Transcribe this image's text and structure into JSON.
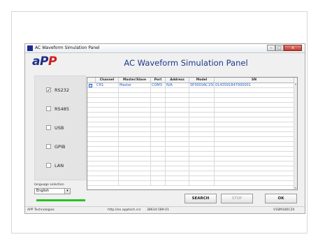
{
  "window": {
    "title": "AC Waveform Simulation Panel",
    "controls": {
      "minimize": "–",
      "maximize": "□",
      "close": "x"
    }
  },
  "header": {
    "logo_main": "aP",
    "logo_accent": "P",
    "panel_title": "AC Waveform Simulation Panel"
  },
  "interfaces": [
    {
      "label": "RS232",
      "checked": true,
      "mark": "✓"
    },
    {
      "label": "RS485",
      "checked": false,
      "mark": ""
    },
    {
      "label": "USB",
      "checked": false,
      "mark": ""
    },
    {
      "label": "GPIB",
      "checked": false,
      "mark": ""
    },
    {
      "label": "LAN",
      "checked": false,
      "mark": ""
    }
  ],
  "language": {
    "label": "language selection",
    "value": "English",
    "arrow": "▾"
  },
  "progress": {
    "percent": 100,
    "color": "#27c227"
  },
  "table": {
    "columns": [
      "",
      "Channel",
      "Master/Slave",
      "Port",
      "Address",
      "Model",
      "SN"
    ],
    "rows": [
      {
        "checked": true,
        "check_mark": "✓",
        "cells": [
          "CH1",
          "Master",
          "COM3",
          "N/A",
          "SP300VAC150(",
          "0143591847000001"
        ]
      }
    ],
    "empty_rows": 20,
    "scroll_up": "▴",
    "scroll_down": "▾"
  },
  "buttons": {
    "search": "SEARCH",
    "stop": "STOP",
    "ok": "OK"
  },
  "status": {
    "company": "APP Technologies",
    "url": "http://en.apptech.cn/",
    "phone": "38634-589-01",
    "version": "V1BM180C20"
  },
  "colors": {
    "accent": "#1a3a8c",
    "table_text": "#1b5fc9",
    "close_button": "#c0392b"
  }
}
